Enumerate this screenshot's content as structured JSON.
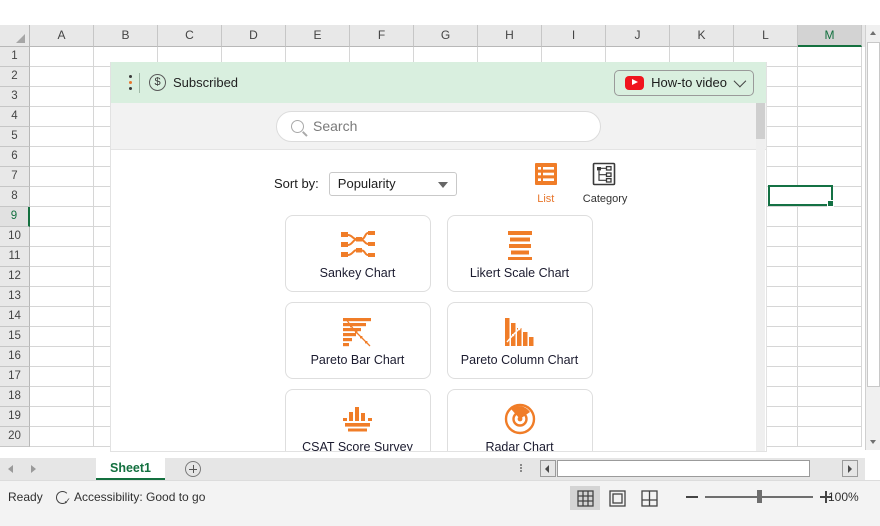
{
  "spreadsheet": {
    "columns": [
      "A",
      "B",
      "C",
      "D",
      "E",
      "F",
      "G",
      "H",
      "I",
      "J",
      "K",
      "L",
      "M"
    ],
    "selected_column": "M",
    "rows": [
      "1",
      "2",
      "3",
      "4",
      "5",
      "6",
      "7",
      "8",
      "9",
      "10",
      "11",
      "12",
      "13",
      "14",
      "15",
      "16",
      "17",
      "18",
      "19",
      "20"
    ],
    "selected_row": "9",
    "sheet_tab": "Sheet1",
    "add_sheet_icon": "plus-circle-icon",
    "prev_sheet_icon": "chevron-left-icon",
    "next_sheet_icon": "chevron-right-icon"
  },
  "status_bar": {
    "ready": "Ready",
    "accessibility": "Accessibility: Good to go",
    "accessibility_icon": "accessibility-checker-icon",
    "views": [
      {
        "name": "normal-view",
        "icon": "grid-icon",
        "active": true
      },
      {
        "name": "page-layout-view",
        "icon": "page-layout-icon",
        "active": false
      },
      {
        "name": "page-break-view",
        "icon": "page-break-icon",
        "active": false
      }
    ],
    "zoom_out_icon": "minus-icon",
    "zoom_in_icon": "plus-icon",
    "zoom_level": "100%"
  },
  "task_pane": {
    "header": {
      "menu_icon": "kebab-menu-icon",
      "subscription_icon": "dollar-circle-icon",
      "subscription_label": "Subscribed",
      "video_button": {
        "icon": "youtube-play-icon",
        "label": "How-to video",
        "chevron": "chevron-down-icon"
      }
    },
    "search": {
      "icon": "search-icon",
      "placeholder": "Search",
      "value": ""
    },
    "toolbar": {
      "sort_label": "Sort by:",
      "sort_value": "Popularity",
      "sort_caret": "caret-down-icon",
      "views": [
        {
          "label": "List",
          "icon": "list-view-icon",
          "active": true
        },
        {
          "label": "Category",
          "icon": "category-view-icon",
          "active": false
        }
      ]
    },
    "charts": [
      [
        {
          "name": "Sankey Chart",
          "icon": "sankey-chart-icon"
        },
        {
          "name": "Likert Scale Chart",
          "icon": "likert-scale-chart-icon"
        }
      ],
      [
        {
          "name": "Pareto Bar Chart",
          "icon": "pareto-bar-chart-icon"
        },
        {
          "name": "Pareto Column Chart",
          "icon": "pareto-column-chart-icon"
        }
      ],
      [
        {
          "name": "CSAT Score Survey",
          "icon": "csat-score-survey-icon"
        },
        {
          "name": "Radar Chart",
          "icon": "radar-chart-icon"
        }
      ]
    ]
  },
  "colors": {
    "accent_orange": "#f07d28",
    "excel_green": "#14703f",
    "header_green_bg": "#d9efdf",
    "youtube_red": "#f0141e"
  }
}
